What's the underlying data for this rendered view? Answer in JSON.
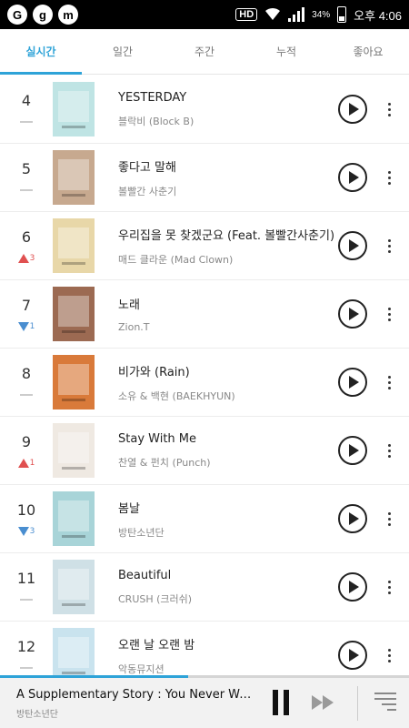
{
  "status": {
    "hd": "HD",
    "battery_pct": "34%",
    "time": "오후 4:06",
    "notif_icons": [
      "G",
      "g",
      "m"
    ]
  },
  "tabs": [
    {
      "label": "실시간",
      "active": true
    },
    {
      "label": "일간",
      "active": false
    },
    {
      "label": "주간",
      "active": false
    },
    {
      "label": "누적",
      "active": false
    },
    {
      "label": "좋아요",
      "active": false
    }
  ],
  "chart": [
    {
      "rank": "4",
      "change": "same",
      "delta": "",
      "title": "YESTERDAY",
      "artist": "블락비 (Block B)",
      "art": "#bfe4e4"
    },
    {
      "rank": "5",
      "change": "same",
      "delta": "",
      "title": "좋다고 말해",
      "artist": "볼빨간 사춘기",
      "art": "#c7a98f"
    },
    {
      "rank": "6",
      "change": "up",
      "delta": "3",
      "title": "우리집을 못 찾겠군요 (Feat. 볼빨간사춘기)",
      "artist": "매드 클라운 (Mad Clown)",
      "art": "#e8d7a8"
    },
    {
      "rank": "7",
      "change": "down",
      "delta": "1",
      "title": "노래",
      "artist": "Zion.T",
      "art": "#9c6a52"
    },
    {
      "rank": "8",
      "change": "same",
      "delta": "",
      "title": "비가와 (Rain)",
      "artist": "소유 & 백현 (BAEKHYUN)",
      "art": "#d97a3a"
    },
    {
      "rank": "9",
      "change": "up",
      "delta": "1",
      "title": "Stay With Me",
      "artist": "찬열 & 펀치 (Punch)",
      "art": "#efe9e2"
    },
    {
      "rank": "10",
      "change": "down",
      "delta": "3",
      "title": "봄날",
      "artist": "방탄소년단",
      "art": "#a8d4d8"
    },
    {
      "rank": "11",
      "change": "same",
      "delta": "",
      "title": "Beautiful",
      "artist": "CRUSH (크러쉬)",
      "art": "#cfe0e6"
    },
    {
      "rank": "12",
      "change": "same",
      "delta": "",
      "title": "오랜 날 오랜 밤",
      "artist": "악동뮤지션",
      "art": "#c9e3ee"
    }
  ],
  "now_playing": {
    "title": "A Supplementary Story : You Never Wa…",
    "artist": "방탄소년단",
    "progress": 0.46
  },
  "colors": {
    "accent": "#2ea3d8",
    "up": "#e05050",
    "down": "#4a8ed0"
  }
}
